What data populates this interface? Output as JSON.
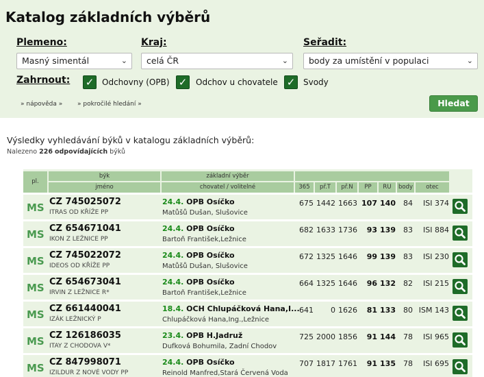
{
  "title": "Katalog základních výběrů",
  "filters": {
    "breed_label": "Plemeno:",
    "breed_value": "Masný simentál",
    "region_label": "Kraj:",
    "region_value": "celá ČR",
    "sort_label": "Seřadit:",
    "sort_value": "body za umístění v populaci",
    "include_label": "Zahrnout:",
    "checkboxes": [
      {
        "label": "Odchovny (OPB)",
        "checked": true
      },
      {
        "label": "Odchov u chovatele",
        "checked": true
      },
      {
        "label": "Svody",
        "checked": true
      }
    ],
    "help_link": "» nápověda »",
    "advanced_link": "» pokročilé hledání »",
    "search_button": "Hledat"
  },
  "results": {
    "heading": "Výsledky vyhledávání býků v katalogu základních výběrů:",
    "found_prefix": "Nalezeno",
    "found_count": "226",
    "found_bold_suffix": "odpovídajících",
    "found_suffix": "býků"
  },
  "table": {
    "headers": {
      "pl": "pl.",
      "byk": "býk",
      "jmeno": "jméno",
      "zakladni_vyber": "základní výběr",
      "chovatel": "chovatel / volitelné",
      "c365": "365",
      "prT": "př.T",
      "prN": "př.N",
      "pp": "PP",
      "ru": "RU",
      "body": "body",
      "otec": "otec"
    },
    "rows": [
      {
        "pl": "MS",
        "code": "CZ 745025072",
        "sire": "ITRAS OD KŘÍŽE PP",
        "date": "24.4.",
        "sel": "OPB Osíčko",
        "breeder": "Matůšů Dušan, Slušovice",
        "c365": "675",
        "prT": "1442",
        "prN": "1663",
        "pp": "107",
        "ru": "140",
        "body": "84",
        "otec": "ISI 374"
      },
      {
        "pl": "MS",
        "code": "CZ 654671041",
        "sire": "IKON Z LEŽNICE PP",
        "date": "24.4.",
        "sel": "OPB Osíčko",
        "breeder": "Bartoň František,Ležnice",
        "c365": "682",
        "prT": "1633",
        "prN": "1736",
        "pp": "93",
        "ru": "139",
        "body": "83",
        "otec": "ISI 884"
      },
      {
        "pl": "MS",
        "code": "CZ 745022072",
        "sire": "IDEOS OD KŘÍŽE PP",
        "date": "24.4.",
        "sel": "OPB Osíčko",
        "breeder": "Matůšů Dušan, Slušovice",
        "c365": "672",
        "prT": "1325",
        "prN": "1646",
        "pp": "99",
        "ru": "139",
        "body": "83",
        "otec": "ISI 230"
      },
      {
        "pl": "MS",
        "code": "CZ 654673041",
        "sire": "IRVIN Z LEŽNICE R*",
        "date": "24.4.",
        "sel": "OPB Osíčko",
        "breeder": "Bartoň František,Ležnice",
        "c365": "664",
        "prT": "1325",
        "prN": "1646",
        "pp": "96",
        "ru": "132",
        "body": "82",
        "otec": "ISI 215"
      },
      {
        "pl": "MS",
        "code": "CZ 661440041",
        "sire": "IZÁK LEŽNICKÝ P",
        "date": "18.4.",
        "sel": "OCH Chlupáčková Hana,I...",
        "breeder": "Chlupáčková Hana,Ing.,Ležnice",
        "c365": "641",
        "prT": "0",
        "prN": "1626",
        "pp": "81",
        "ru": "133",
        "body": "80",
        "otec": "ISM 143"
      },
      {
        "pl": "MS",
        "code": "CZ 126186035",
        "sire": "ITAY Z CHODOVA V*",
        "date": "23.4.",
        "sel": "OPB H.Jadruž",
        "breeder": "Dufková Bohumila, Zadní Chodov",
        "c365": "725",
        "prT": "2000",
        "prN": "1856",
        "pp": "91",
        "ru": "144",
        "body": "78",
        "otec": "ISI 965"
      },
      {
        "pl": "MS",
        "code": "CZ 847998071",
        "sire": "IZILDUR Z NOVÉ VODY PP",
        "date": "24.4.",
        "sel": "OPB Osíčko",
        "breeder": "Reinold Manfred,Stará Červená Voda",
        "c365": "707",
        "prT": "1817",
        "prN": "1761",
        "pp": "91",
        "ru": "135",
        "body": "78",
        "otec": "ISI 695"
      }
    ]
  },
  "colors": {
    "accent": "#1e6b28",
    "panel": "#eaf3e3",
    "header": "#a9cc9f",
    "date_green": "#1a8a1a",
    "ms_green": "#4a9a50",
    "button": "#4a9a4a"
  }
}
